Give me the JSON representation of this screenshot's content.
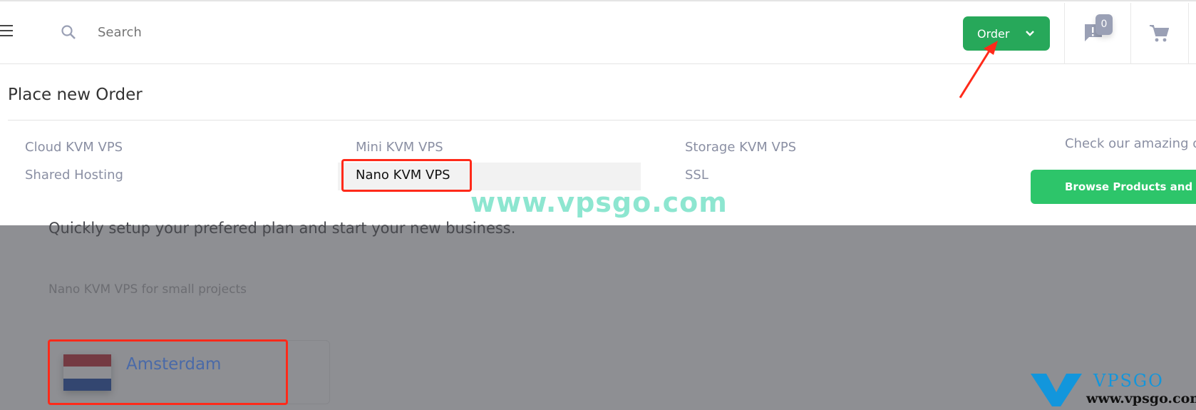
{
  "header": {
    "search_placeholder": "Search",
    "order_label": "Order",
    "notifications_count": "0"
  },
  "order_menu": {
    "title": "Place new Order",
    "columns": [
      [
        "Cloud KVM VPS",
        "Shared Hosting"
      ],
      [
        "Mini KVM VPS",
        "Nano KVM VPS"
      ],
      [
        "Storage KVM VPS",
        "SSL"
      ]
    ],
    "selected": "Nano KVM VPS",
    "promo_text": "Check our amazing offers",
    "browse_label": "Browse Products and Services"
  },
  "page": {
    "subtitle": "Quickly setup your prefered plan and start your new business.",
    "category_desc": "Nano KVM VPS for small projects",
    "locations": [
      {
        "name": "Amsterdam",
        "flag": "netherlands"
      }
    ]
  },
  "watermark": {
    "text": "www.vpsgo.com",
    "logo_text": "VPSGO",
    "logo_sub": "www.vpsgo.com"
  },
  "colors": {
    "order_green": "#27a85a",
    "browse_green": "#2dc56a",
    "annotation_red": "#ff2a1a",
    "watermark": "#8de6d0"
  }
}
